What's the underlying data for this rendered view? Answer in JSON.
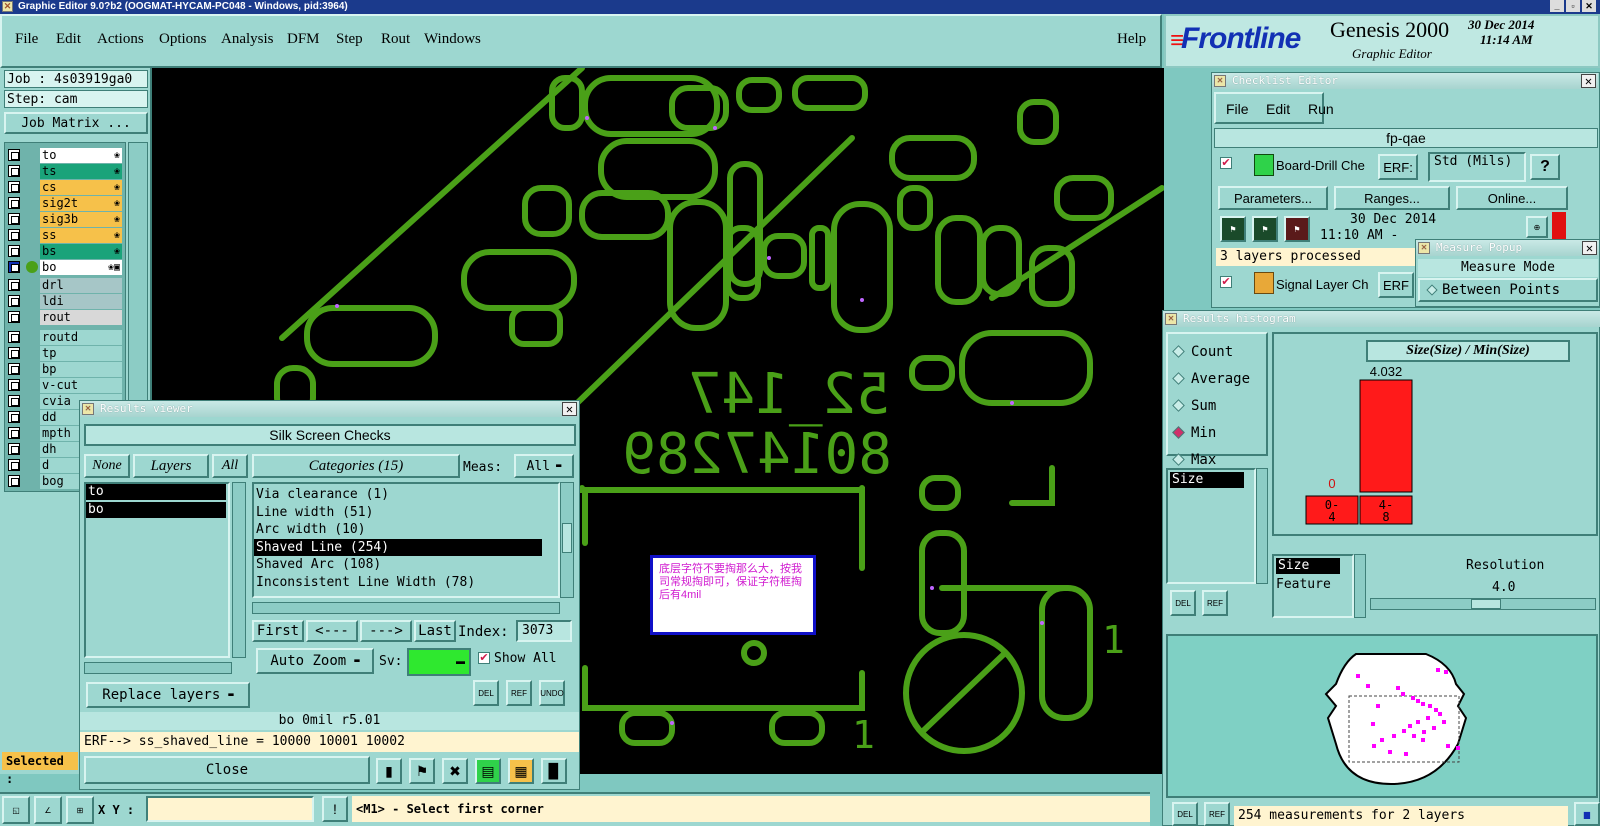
{
  "window_title": "Graphic Editor 9.0?b2 (OOGMAT-HYCAM-PC048 - Windows, pid:3964)",
  "menubar": {
    "items": [
      "File",
      "Edit",
      "Actions",
      "Options",
      "Analysis",
      "DFM",
      "Step",
      "Rout",
      "Windows"
    ],
    "help": "Help"
  },
  "brand": {
    "logo": "Frontline",
    "product": "Genesis 2000",
    "subtitle": "Graphic Editor",
    "date": "30 Dec 2014",
    "time": "11:14 AM"
  },
  "job_panel": {
    "job": "Job : 4s03919ga0",
    "step": "Step: cam",
    "matrix_button": "Job Matrix ..."
  },
  "layers": [
    {
      "name": "to",
      "color": "#ffffff",
      "mark": "❀"
    },
    {
      "name": "ts",
      "color": "#1aa37a",
      "mark": "❀"
    },
    {
      "name": "cs",
      "color": "#f6c14a",
      "mark": "❀"
    },
    {
      "name": "sig2t",
      "color": "#f6c14a",
      "mark": "❀"
    },
    {
      "name": "sig3b",
      "color": "#f6c14a",
      "mark": "❀"
    },
    {
      "name": "ss",
      "color": "#f6c14a",
      "mark": "❀"
    },
    {
      "name": "bs",
      "color": "#1aa37a",
      "mark": "❀"
    },
    {
      "name": "bo",
      "color": "#ffffff",
      "mark": "❀▣"
    },
    {
      "name": "drl",
      "color": "#a6c6c7",
      "mark": ""
    },
    {
      "name": "ldi",
      "color": "#a6c6c7",
      "mark": ""
    },
    {
      "name": "rout",
      "color": "#d8d8d8",
      "mark": ""
    },
    {
      "name": "routd",
      "color": "#9dd7d0",
      "mark": ""
    },
    {
      "name": "tp",
      "color": "#9dd7d0",
      "mark": ""
    },
    {
      "name": "bp",
      "color": "#9dd7d0",
      "mark": ""
    },
    {
      "name": "v-cut",
      "color": "#9dd7d0",
      "mark": ""
    },
    {
      "name": "cvia",
      "color": "#9dd7d0",
      "mark": ""
    },
    {
      "name": "dd",
      "color": "#9dd7d0",
      "mark": ""
    },
    {
      "name": "mpth",
      "color": "#9dd7d0",
      "mark": ""
    },
    {
      "name": "dh",
      "color": "#9dd7d0",
      "mark": ""
    },
    {
      "name": "d",
      "color": "#9dd7d0",
      "mark": ""
    },
    {
      "name": "bog",
      "color": "#9dd7d0",
      "mark": ""
    }
  ],
  "selected_label": "Selected :",
  "bottom_bar": {
    "xy_label": "X Y :",
    "xy_value": "",
    "hint": "<M1> - Select first corner"
  },
  "canvas_text": {
    "mirrored_1": "52_147",
    "mirrored_2": "80147289",
    "note": "底层字符不要掏那么大，按我司常规掏即可，保证字符框掏后有4mil"
  },
  "results_viewer": {
    "title": "Results viewer",
    "header": "Silk Screen Checks",
    "none": "None",
    "layers": "Layers",
    "all": "All",
    "categories": "Categories (15)",
    "meas_label": "Meas:",
    "meas_value": "All",
    "layer_list": [
      "to",
      "bo"
    ],
    "category_list": [
      "Via clearance (1)",
      "Line width (51)",
      "Arc width (10)",
      "Shaved Line (254)",
      "Shaved Arc (108)",
      "Inconsistent Line Width (78)"
    ],
    "selected_category": 3,
    "first": "First",
    "prev": "<---",
    "next": "--->",
    "last": "Last",
    "index_label": "Index:",
    "index_value": "3073",
    "auto_zoom": "Auto Zoom",
    "sv_label": "Sv:",
    "show_all": "Show All",
    "replace_layers": "Replace layers",
    "status": "bo 0mil  r5.01",
    "erf": "ERF--> ss_shaved_line = 10000 10001 10002",
    "close": "Close",
    "del": "DEL",
    "ref": "REF",
    "undo": "UNDO"
  },
  "checklist": {
    "title": "Checklist Editor",
    "menu": [
      "File",
      "Edit",
      "Run"
    ],
    "name": "fp-qae",
    "item1": "Board-Drill Che",
    "erf_btn": "ERF:",
    "erf_value": "Std (Mils)",
    "help": "?",
    "params": "Parameters...",
    "ranges": "Ranges...",
    "online": "Online...",
    "date": "30 Dec 2014",
    "time": "11:10 AM - ",
    "processed": "3 layers processed",
    "item2": "Signal Layer Ch",
    "erf2": "ERF"
  },
  "measure_popup": {
    "title": "Measure Popup",
    "mode_label": "Measure Mode",
    "mode_value": "Between Points"
  },
  "histogram": {
    "title": "Results histogram",
    "options": [
      "Count",
      "Average",
      "Sum",
      "Min",
      "Max"
    ],
    "selected_option": 3,
    "chart_title": "Size(Size) / Min(Size)",
    "bins": [
      "0-4",
      "4-8"
    ],
    "bin_values": [
      0,
      4.032
    ],
    "value_labels": [
      "0",
      "4.032"
    ],
    "ymax": 4.032,
    "size_list": [
      "Size"
    ],
    "attr_list": [
      "Size",
      "Feature"
    ],
    "resolution_label": "Resolution",
    "resolution_value": "4.0",
    "measurements": "254 measurements for 2 layers",
    "del": "DEL",
    "ref": "REF"
  },
  "colors": {
    "panel": "#9dd7d0",
    "canvas": "#000000",
    "feature": "#4aa018",
    "bar": "#ff1a1a",
    "marker": "#ff00ff"
  }
}
